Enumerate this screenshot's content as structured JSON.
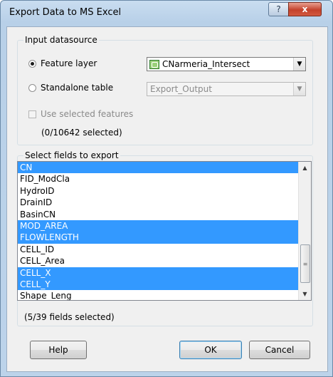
{
  "window": {
    "title": "Export Data to MS Excel",
    "help_label": "?",
    "close_label": "x"
  },
  "input_datasource": {
    "legend": "Input datasource",
    "feature_layer_label": "Feature layer",
    "feature_layer_value": "CNarmeria_Intersect",
    "standalone_table_label": "Standalone table",
    "standalone_table_value": "Export_Output",
    "use_selected_label": "Use selected features",
    "selection_count": "(0/10642 selected)"
  },
  "fields": {
    "legend": "Select fields to export",
    "items": [
      {
        "label": "CN",
        "selected": true
      },
      {
        "label": "FID_ModCla",
        "selected": false
      },
      {
        "label": "HydroID",
        "selected": false
      },
      {
        "label": "DrainID",
        "selected": false
      },
      {
        "label": "BasinCN",
        "selected": false
      },
      {
        "label": "MOD_AREA",
        "selected": true
      },
      {
        "label": "FLOWLENGTH",
        "selected": true
      },
      {
        "label": "CELL_ID",
        "selected": false
      },
      {
        "label": "CELL_Area",
        "selected": false
      },
      {
        "label": "CELL_X",
        "selected": true
      },
      {
        "label": "CELL_Y",
        "selected": true
      },
      {
        "label": "Shape_Leng",
        "selected": false
      }
    ],
    "fields_count": "(5/39 fields selected)"
  },
  "buttons": {
    "help": "Help",
    "ok": "OK",
    "cancel": "Cancel"
  },
  "colors": {
    "selection": "#3399ff",
    "close_button": "#c4412b"
  }
}
